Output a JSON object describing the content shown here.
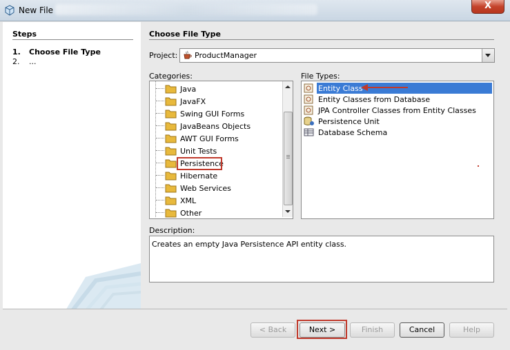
{
  "window": {
    "title": "New File",
    "close_symbol": "X"
  },
  "steps": {
    "heading": "Steps",
    "items": [
      {
        "num": "1.",
        "label": "Choose File Type",
        "active": true
      },
      {
        "num": "2.",
        "label": "...",
        "active": false
      }
    ]
  },
  "main": {
    "heading": "Choose File Type",
    "project_label": "Project:",
    "project_value": "ProductManager",
    "categories_label": "Categories:",
    "categories": [
      "Java",
      "JavaFX",
      "Swing GUI Forms",
      "JavaBeans Objects",
      "AWT GUI Forms",
      "Unit Tests",
      "Persistence",
      "Hibernate",
      "Web Services",
      "XML",
      "Other"
    ],
    "selected_category": "Persistence",
    "file_types_label": "File Types:",
    "file_types": [
      {
        "label": "Entity Class",
        "icon": "entity-class-icon"
      },
      {
        "label": "Entity Classes from Database",
        "icon": "entity-db-icon"
      },
      {
        "label": "JPA Controller Classes from Entity Classes",
        "icon": "jpa-controller-icon"
      },
      {
        "label": "Persistence Unit",
        "icon": "persistence-unit-icon"
      },
      {
        "label": "Database Schema",
        "icon": "database-schema-icon"
      }
    ],
    "selected_file_type": "Entity Class",
    "description_label": "Description:",
    "description": "Creates an empty Java Persistence API entity class."
  },
  "buttons": {
    "back": "< Back",
    "next": "Next >",
    "finish": "Finish",
    "cancel": "Cancel",
    "help": "Help"
  },
  "colors": {
    "selection": "#3a7bd5",
    "annotation": "#c0392b",
    "folder": "#e8b93c"
  }
}
